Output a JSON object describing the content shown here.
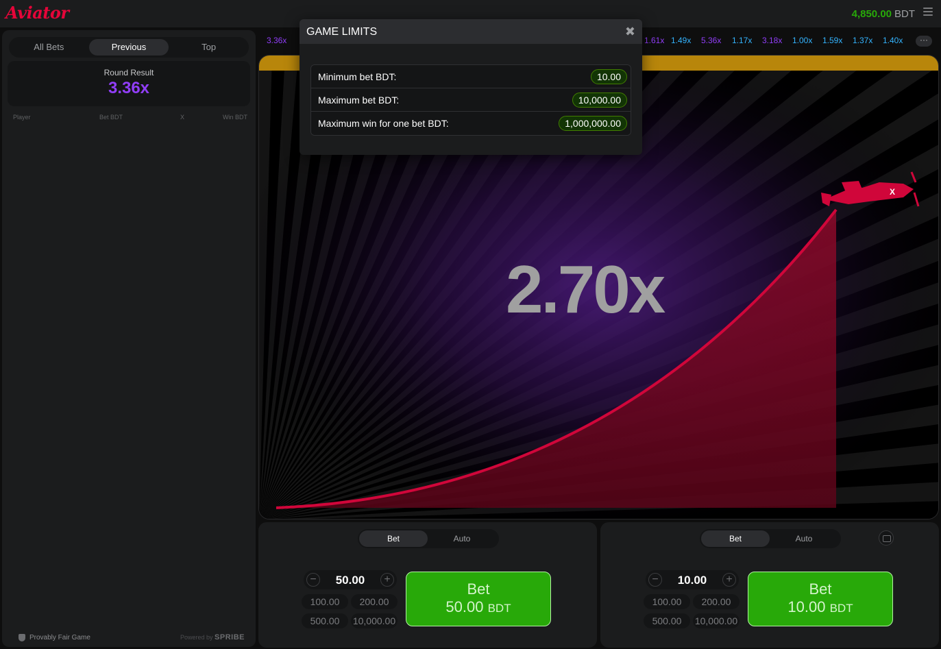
{
  "app": {
    "logo": "Aviator",
    "balance": "4,850.00",
    "currency": "BDT"
  },
  "left_panel": {
    "tabs": [
      "All Bets",
      "Previous",
      "Top"
    ],
    "active_tab": "Previous",
    "round_result_label": "Round Result",
    "round_result_value": "3.36x",
    "columns": [
      "Player",
      "Bet BDT",
      "X",
      "Win BDT"
    ],
    "provably_fair": "Provably Fair Game",
    "powered_by": "Powered by",
    "powered_by_brand": "SPRIBE"
  },
  "history": [
    {
      "value": "3.36x",
      "color": "#913ef8"
    },
    {
      "value": "1.61x",
      "color": "#913ef8"
    },
    {
      "value": "1.49x",
      "color": "#34b4ff"
    },
    {
      "value": "5.36x",
      "color": "#913ef8"
    },
    {
      "value": "1.17x",
      "color": "#34b4ff"
    },
    {
      "value": "3.18x",
      "color": "#913ef8"
    },
    {
      "value": "1.00x",
      "color": "#34b4ff"
    },
    {
      "value": "1.59x",
      "color": "#34b4ff"
    },
    {
      "value": "1.37x",
      "color": "#34b4ff"
    },
    {
      "value": "1.40x",
      "color": "#34b4ff"
    }
  ],
  "history_more": "···",
  "game": {
    "multiplier": "2.70x"
  },
  "bet_panels": [
    {
      "tabs": [
        "Bet",
        "Auto"
      ],
      "stake": "50.00",
      "quick": [
        "100.00",
        "200.00",
        "500.00",
        "10,000.00"
      ],
      "bet_label": "Bet",
      "bet_amount": "50.00",
      "bet_currency": "BDT"
    },
    {
      "tabs": [
        "Bet",
        "Auto"
      ],
      "stake": "10.00",
      "quick": [
        "100.00",
        "200.00",
        "500.00",
        "10,000.00"
      ],
      "bet_label": "Bet",
      "bet_amount": "10.00",
      "bet_currency": "BDT"
    }
  ],
  "modal": {
    "title": "GAME LIMITS",
    "close": "✖",
    "rows": [
      {
        "label": "Minimum bet BDT:",
        "value": "10.00"
      },
      {
        "label": "Maximum bet BDT:",
        "value": "10,000.00"
      },
      {
        "label": "Maximum win for one bet BDT:",
        "value": "1,000,000.00"
      }
    ]
  },
  "colors": {
    "brand_red": "#e50539",
    "green": "#28a909",
    "purple": "#913ef8",
    "blue": "#34b4ff"
  }
}
